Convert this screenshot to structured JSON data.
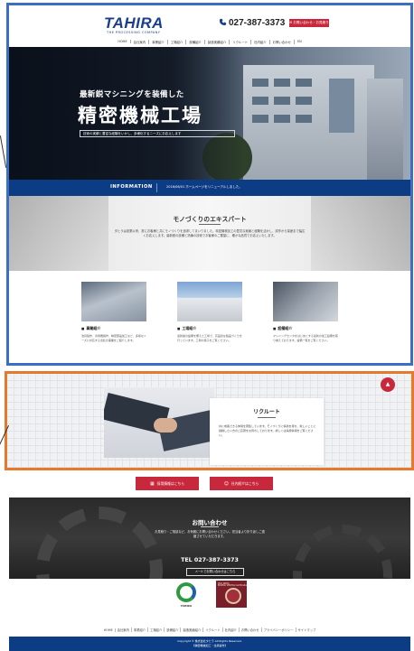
{
  "header": {
    "logo": "TAHIRA",
    "logo_sub": "THE PROCESSING COMPANY",
    "phone": "027-387-3373",
    "contact_button": "お問い合わせ・お見積り"
  },
  "gnav": [
    "HOME",
    "会社案内",
    "事業紹介",
    "工場紹介",
    "設備紹介",
    "製造実績紹介",
    "リクルート",
    "社内紹介",
    "お問い合わせ",
    "EN"
  ],
  "hero": {
    "catch": "最新鋭マシニングを装備した",
    "title": "精密機械工場",
    "sub": "技術の実績と豊富な経験をいかし、多様化するニーズにお応えします"
  },
  "info": {
    "label": "INFORMATION",
    "text": "2016/06/01 ホームページをリニューアルしました。"
  },
  "mono": {
    "title": "モノづくりのエキスパート",
    "text": "タヒラは創業以来、常にお客様と共にモノづくりを追求してまいりました。精密機械加工の豊富な実績と経験を活かし、試作から量産まで幅広くお応えします。最新鋭の設備と熟練の技術でお客様のご要望に、確かな品質でお応えいたします。"
  },
  "services": [
    {
      "label": "事業紹介",
      "text": "治具製作、専用機製作、精密部品加工など、多様なニーズに対応する当社の事業をご紹介します。"
    },
    {
      "label": "工場紹介",
      "text": "最新鋭の設備を備えた工場で、高品質な製品づくりを行っています。工場の様子をご覧ください。"
    },
    {
      "label": "設備紹介",
      "text": "マシニングセンタをはじめとする最新の加工設備を取り揃えております。設備一覧をご覧ください。"
    }
  ],
  "recruit": {
    "title": "リクルート",
    "text": "共に成長できる仲間を募集しています。モノづくりに情熱を持ち、新しいことに挑戦したい方のご応募をお待ちしております。詳しくは採用情報をご覧ください。"
  },
  "cta": {
    "left": "採用情報はこちら",
    "right": "社内紹介はこちら"
  },
  "contact": {
    "title": "お問い合わせ",
    "text": "お見積り・ご相談など、お気軽にお問い合わせください。担当者より折り返しご連絡させていただきます。",
    "tel": "TEL 027-387-3373",
    "button": "メールでお問い合わせはこちら"
  },
  "logos": {
    "g_label": "TAHIRA",
    "iso_label": "ISO 9001",
    "iso_cert": "BUREAU VERITAS Certification"
  },
  "fnav": [
    "HOME",
    "会社案内",
    "事業紹介",
    "工場紹介",
    "設備紹介",
    "製造実績紹介",
    "リクルート",
    "社内紹介",
    "お問い合わせ",
    "プライバシーポリシー",
    "サイトマップ"
  ],
  "copyright": {
    "line1": "Copyright © 株式会社タヒラ All Rights Reserved.",
    "line2": "【精密機械加工・治具製作】"
  },
  "colors": {
    "brand_blue": "#0c3c84",
    "accent_red": "#c8283c",
    "frame_blue": "#3a6fc4",
    "frame_orange": "#e7782c"
  }
}
